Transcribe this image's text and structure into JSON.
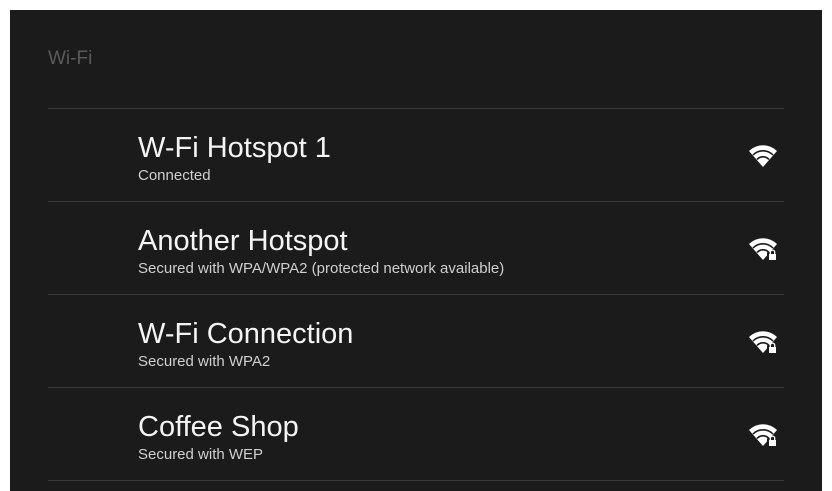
{
  "header": {
    "title": "Wi-Fi"
  },
  "networks": [
    {
      "ssid": "W-Fi Hotspot 1",
      "status": "Connected",
      "icon": "wifi-signal-icon",
      "secured": false
    },
    {
      "ssid": "Another Hotspot",
      "status": "Secured with WPA/WPA2 (protected network available)",
      "icon": "wifi-secured-icon",
      "secured": true
    },
    {
      "ssid": "W-Fi Connection",
      "status": "Secured with WPA2",
      "icon": "wifi-secured-icon",
      "secured": true
    },
    {
      "ssid": "Coffee Shop",
      "status": "Secured with WEP",
      "icon": "wifi-secured-icon",
      "secured": true
    }
  ],
  "colors": {
    "background": "#1b1b1b",
    "divider": "#3a3a3a",
    "header_text": "#5a5a5a",
    "primary_text": "#f4f4f4",
    "secondary_text": "#cfcfcf"
  }
}
